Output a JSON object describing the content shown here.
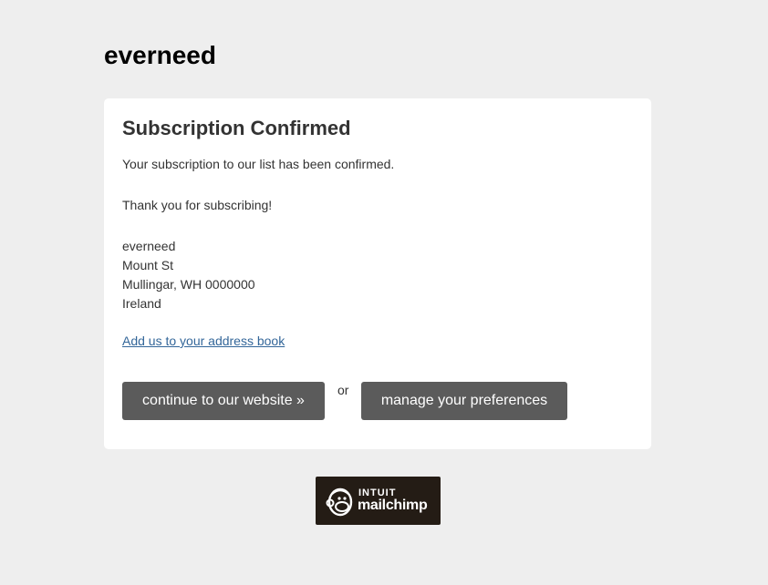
{
  "header": {
    "brand_name": "everneed"
  },
  "card": {
    "title": "Subscription Confirmed",
    "confirmation_text": "Your subscription to our list has been confirmed.",
    "thanks_text": "Thank you for subscribing!",
    "address": {
      "line1": "everneed",
      "line2": "Mount St",
      "line3": "Mullingar, WH 0000000",
      "line4": "Ireland"
    },
    "address_book_link": "Add us to your address book",
    "continue_button": "continue to our website »",
    "or_text": "or",
    "preferences_button": "manage your preferences"
  },
  "footer": {
    "badge": {
      "line1": "INTUIT",
      "line2": "mailchimp",
      "icon": "mailchimp-freddie-icon",
      "background": "#241c15"
    }
  },
  "colors": {
    "page_background": "#eeeeee",
    "card_background": "#ffffff",
    "button_background": "#5b5b5b",
    "link": "#336699"
  }
}
